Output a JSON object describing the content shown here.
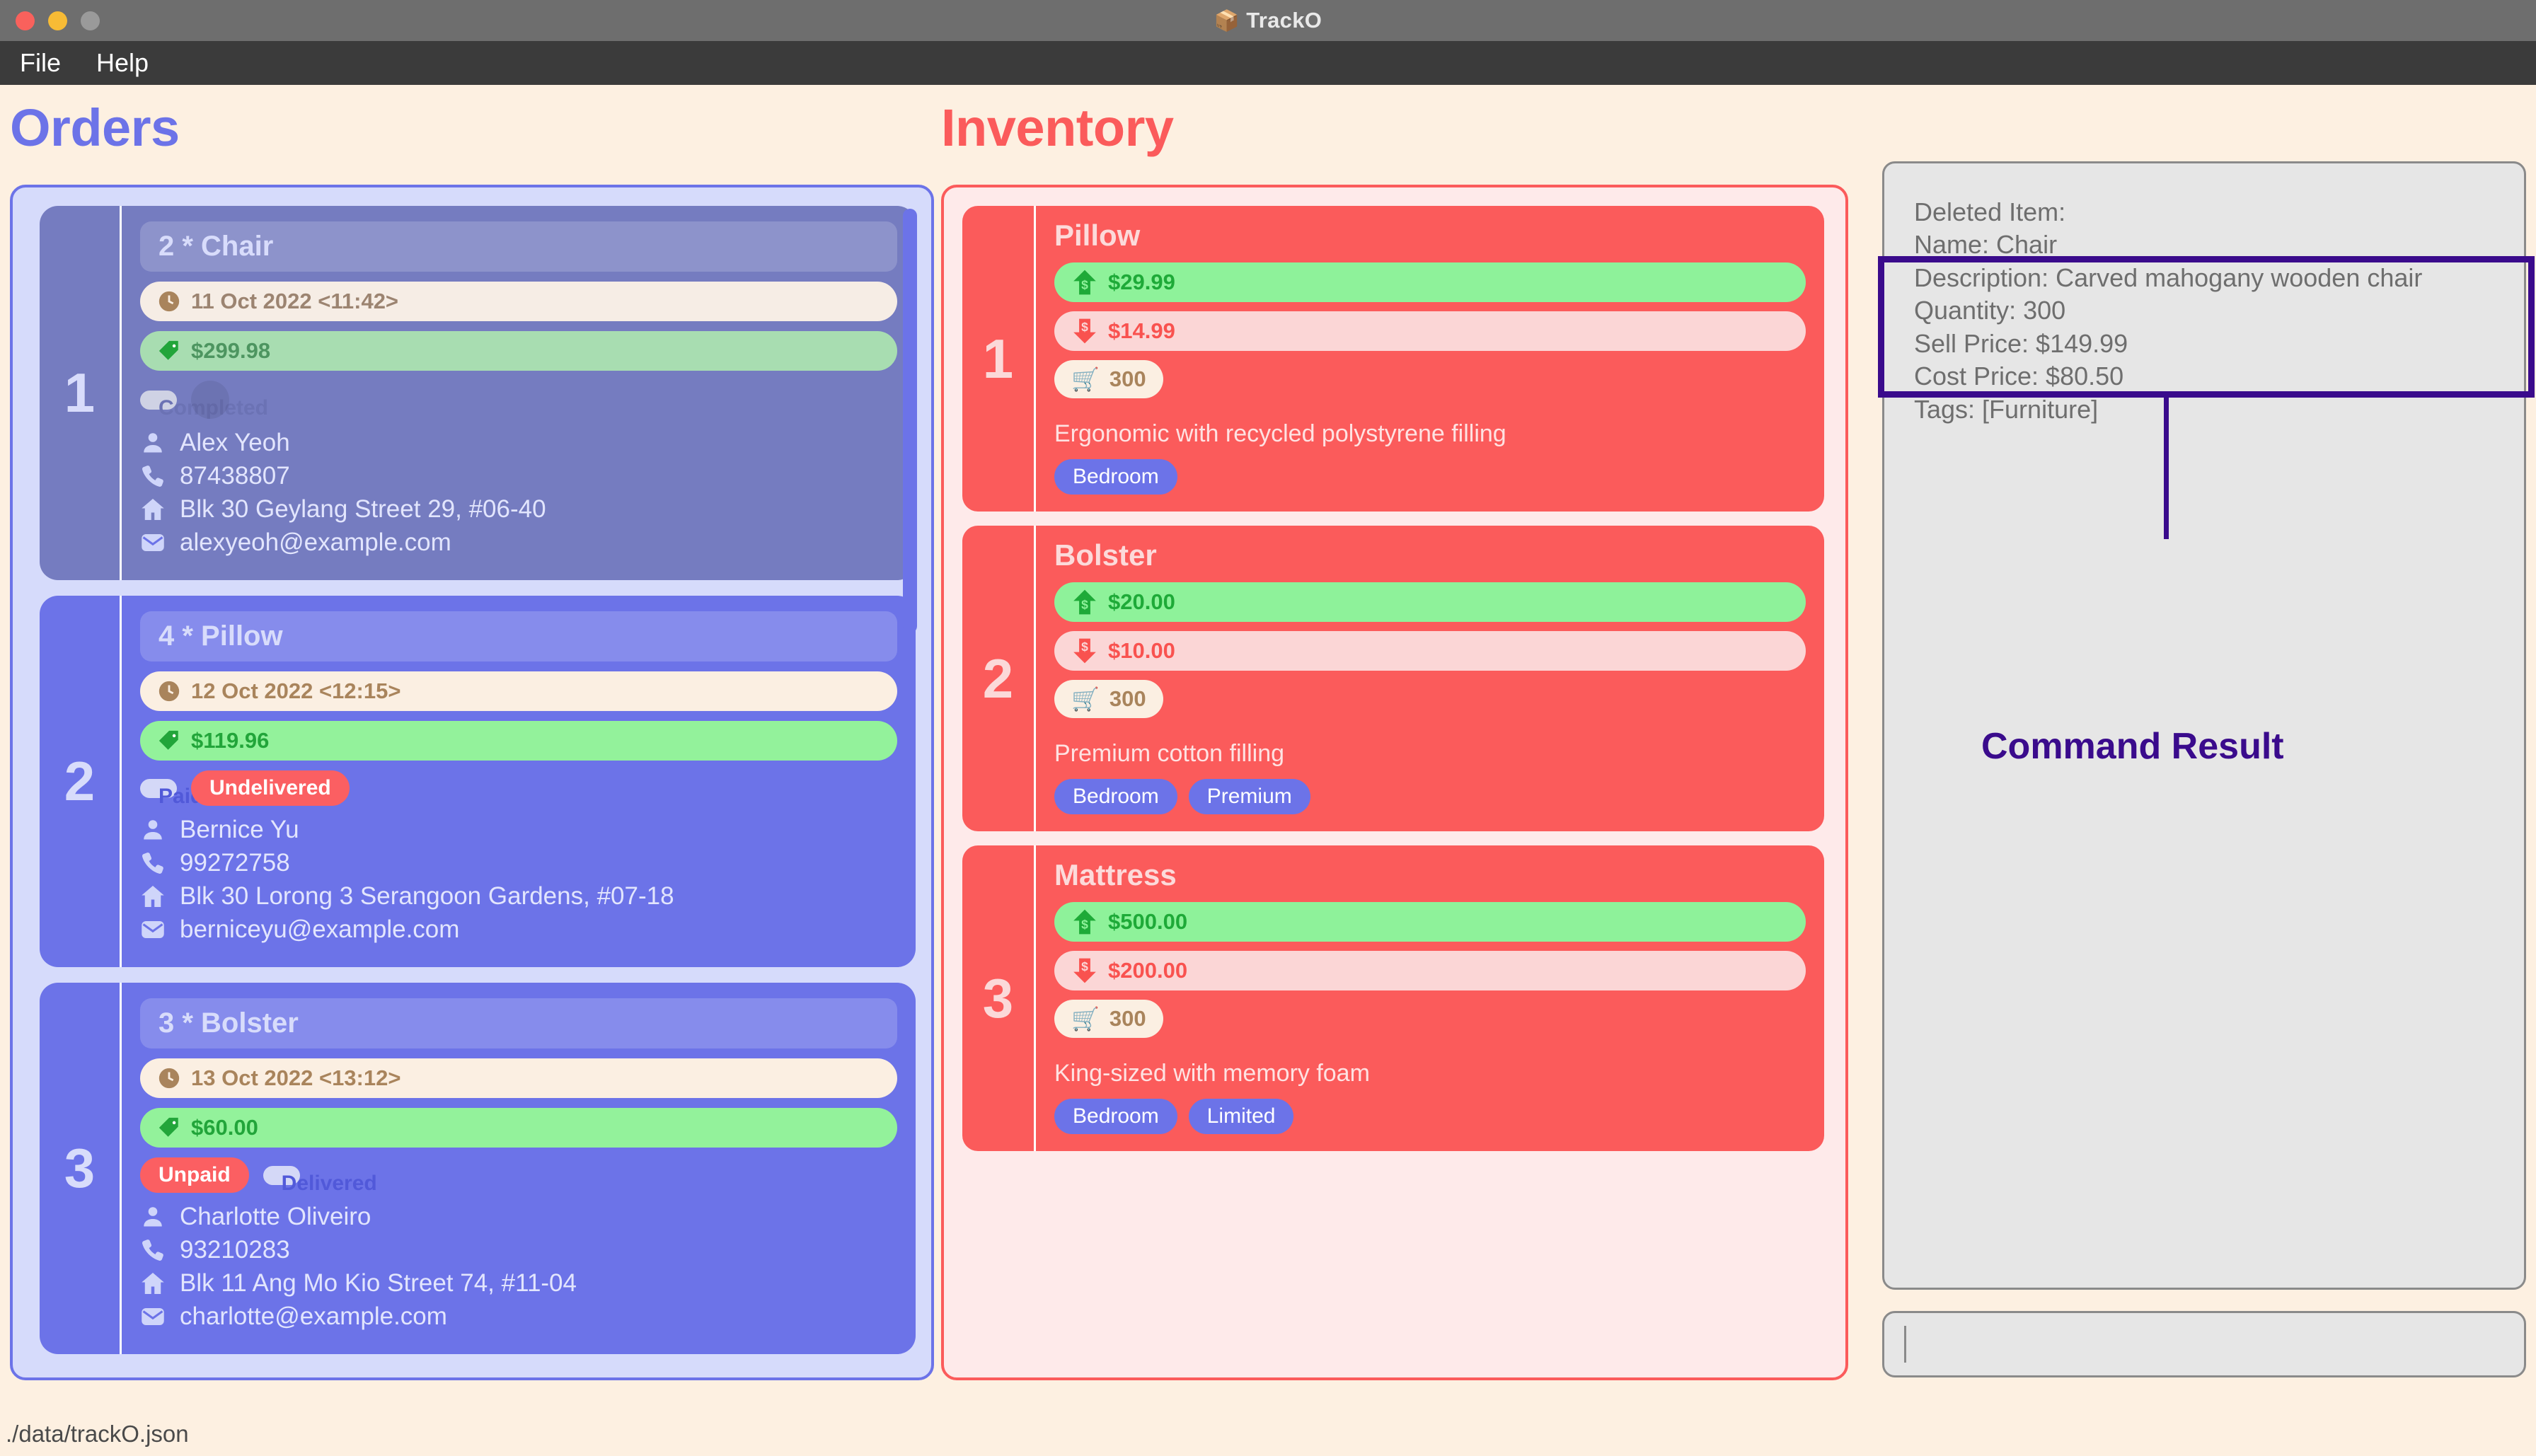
{
  "window": {
    "title": "TrackO",
    "icon": "package-box",
    "traffic_lights": [
      "close",
      "minimize",
      "maximize"
    ]
  },
  "menubar": {
    "items": [
      "File",
      "Help"
    ]
  },
  "orders": {
    "title": "Orders",
    "accent": "#6C73E8",
    "panel_bg": "#D6DBFB",
    "cards": [
      {
        "index": "1",
        "selected": true,
        "heading": "2 * Chair",
        "date": "11 Oct 2022 <11:42>",
        "price": "$299.98",
        "badges": [
          {
            "label": "Completed",
            "style": "light"
          }
        ],
        "has_ghost_dot": true,
        "customer": "Alex Yeoh",
        "phone": "87438807",
        "address": "Blk 30 Geylang Street 29, #06-40",
        "email": "alexyeoh@example.com"
      },
      {
        "index": "2",
        "selected": false,
        "heading": "4 * Pillow",
        "date": "12 Oct 2022 <12:15>",
        "price": "$119.96",
        "badges": [
          {
            "label": "Paid",
            "style": "light"
          },
          {
            "label": "Undelivered",
            "style": "danger"
          }
        ],
        "has_ghost_dot": false,
        "customer": "Bernice Yu",
        "phone": "99272758",
        "address": "Blk 30 Lorong 3 Serangoon Gardens, #07-18",
        "email": "berniceyu@example.com"
      },
      {
        "index": "3",
        "selected": false,
        "heading": "3 * Bolster",
        "date": "13 Oct 2022 <13:12>",
        "price": "$60.00",
        "badges": [
          {
            "label": "Unpaid",
            "style": "danger"
          },
          {
            "label": "Delivered",
            "style": "light"
          }
        ],
        "has_ghost_dot": false,
        "customer": "Charlotte Oliveiro",
        "phone": "93210283",
        "address": "Blk 11 Ang Mo Kio Street 74, #11-04",
        "email": "charlotte@example.com"
      }
    ]
  },
  "inventory": {
    "title": "Inventory",
    "accent": "#FB5B5B",
    "panel_bg": "#FEEAEA",
    "cards": [
      {
        "index": "1",
        "name": "Pillow",
        "sell_price": "$29.99",
        "cost_price": "$14.99",
        "quantity": "300",
        "description": "Ergonomic with recycled polystyrene filling",
        "tags": [
          "Bedroom"
        ]
      },
      {
        "index": "2",
        "name": "Bolster",
        "sell_price": "$20.00",
        "cost_price": "$10.00",
        "quantity": "300",
        "description": "Premium cotton filling",
        "tags": [
          "Bedroom",
          "Premium"
        ]
      },
      {
        "index": "3",
        "name": "Mattress",
        "sell_price": "$500.00",
        "cost_price": "$200.00",
        "quantity": "300",
        "description": "King-sized with memory foam",
        "tags": [
          "Bedroom",
          "Limited"
        ]
      }
    ]
  },
  "result": {
    "lines": [
      "Deleted Item:",
      "Name: Chair",
      "Description: Carved mahogany wooden chair",
      "Quantity: 300",
      "Sell Price: $149.99",
      "Cost Price: $80.50",
      "Tags: [Furniture]"
    ]
  },
  "command": {
    "value": "",
    "placeholder": ""
  },
  "annotation": {
    "label": "Command Result",
    "color": "#3A0B8C"
  },
  "statusbar": {
    "path": "./data/trackO.json"
  }
}
